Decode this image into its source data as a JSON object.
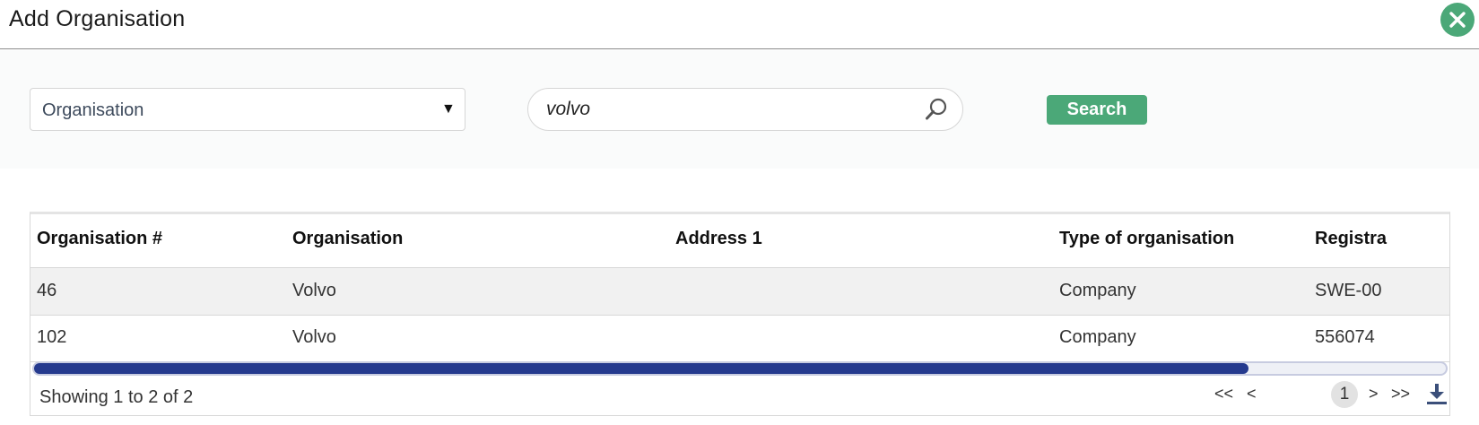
{
  "dialog": {
    "title": "Add Organisation"
  },
  "filter": {
    "select_value": "Organisation",
    "search_value": "volvo",
    "search_button_label": "Search"
  },
  "table": {
    "columns": [
      "Organisation #",
      "Organisation",
      "Address 1",
      "Type of organisation",
      "Registra"
    ],
    "rows": [
      [
        "46",
        "Volvo",
        "",
        "Company",
        "SWE-00"
      ],
      [
        "102",
        "Volvo",
        "",
        "Company",
        "556074"
      ]
    ],
    "scroll_fraction": 0.86
  },
  "footer": {
    "summary": "Showing 1 to 2 of 2",
    "pager": {
      "first": "<<",
      "prev": "<",
      "current": "1",
      "next": ">",
      "last": ">>"
    }
  },
  "colors": {
    "accent_green": "#4ba878",
    "scrollbar_thumb": "#253a8e"
  },
  "icons": {
    "close": "close-icon",
    "search": "search-icon",
    "dropdown": "dropdown-arrow-icon",
    "download": "download-icon"
  }
}
